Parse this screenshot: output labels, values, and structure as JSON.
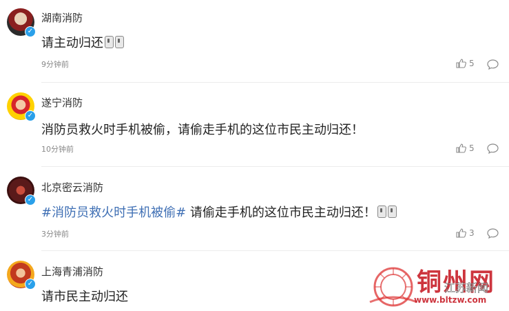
{
  "comments": [
    {
      "user": "湖南消防",
      "text": "请主动归还",
      "emoji_count": 2,
      "time": "9分钟前",
      "likes": "5",
      "avatar_color": "#8a1f1f"
    },
    {
      "user": "遂宁消防",
      "text": "消防员救火时手机被偷，请偷走手机的这位市民主动归还！",
      "emoji_count": 0,
      "time": "10分钟前",
      "likes": "5",
      "avatar_color": "#d7262b"
    },
    {
      "user": "北京密云消防",
      "hashtag": "#消防员救火时手机被偷#",
      "text": " 请偷走手机的这位市民主动归还！",
      "emoji_count": 2,
      "time": "3分钟前",
      "likes": "3",
      "avatar_color": "#5a1a1a"
    },
    {
      "user": "上海青浦消防",
      "text": "请市民主动归还",
      "emoji_count": 0,
      "time": "",
      "likes": "",
      "avatar_color": "#c23a1e"
    }
  ],
  "watermark": {
    "brand": "铜州网",
    "sub": "江苏新闻",
    "url": "www.bltzw.com"
  },
  "colors": {
    "verified": "#2aa0ea",
    "hashtag": "#3f6fb4",
    "meta": "#888888"
  },
  "icons": [
    "thumbs-up-icon",
    "comment-bubble-icon",
    "verified-badge-icon",
    "emoji-icon"
  ]
}
